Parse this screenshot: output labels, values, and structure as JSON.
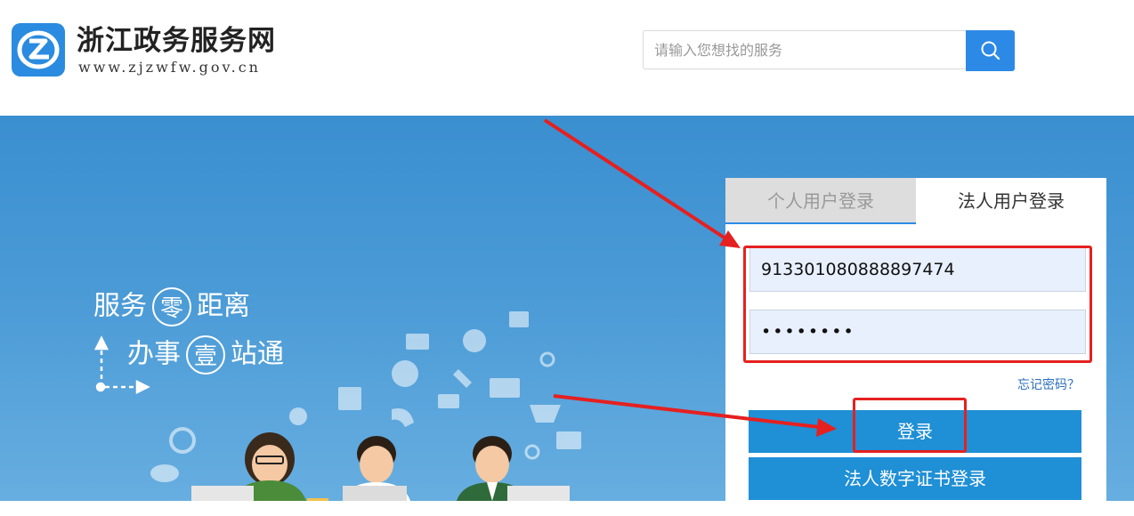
{
  "header": {
    "title": "浙江政务服务网",
    "url": "www.zjzwfw.gov.cn",
    "search_placeholder": "请输入您想找的服务",
    "search_icon": "search-icon"
  },
  "banner": {
    "slogan1": {
      "pre": "服务",
      "ring": "零",
      "post": "距离"
    },
    "slogan2": {
      "pre": "办事",
      "ring": "壹",
      "post": "站通"
    }
  },
  "login": {
    "tabs": [
      "个人用户登录",
      "法人用户登录"
    ],
    "active_tab": "法人用户登录",
    "username_value": "913301080888897474",
    "password_mask": "••••••••",
    "forgot_label": "忘记密码？",
    "login_button": "登录",
    "cert_button": "法人数字证书登录"
  },
  "colors": {
    "primary": "#2c8ae6",
    "button": "#1f8fd6",
    "annotation_red": "#e52020",
    "banner_top": "#3a8fd0"
  }
}
